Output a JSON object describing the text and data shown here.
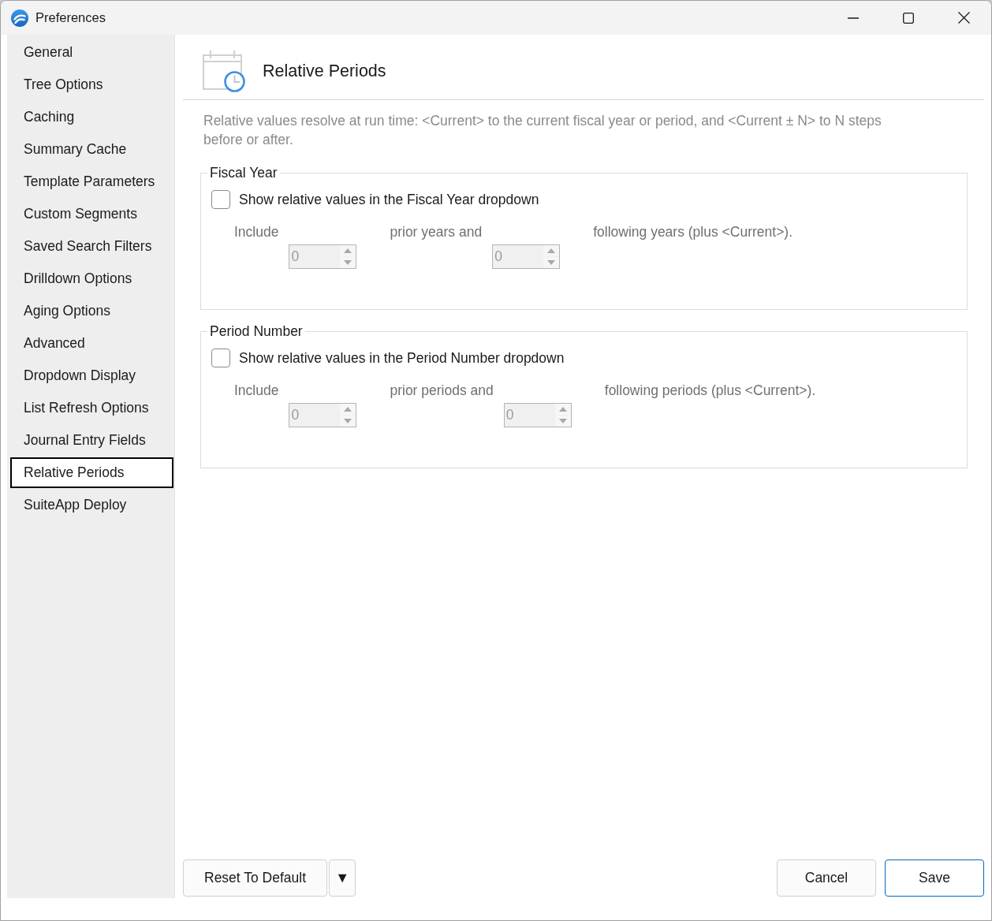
{
  "window": {
    "title": "Preferences"
  },
  "sidebar": {
    "items": [
      {
        "label": "General",
        "selected": false
      },
      {
        "label": "Tree Options",
        "selected": false
      },
      {
        "label": "Caching",
        "selected": false
      },
      {
        "label": "Summary Cache",
        "selected": false
      },
      {
        "label": "Template Parameters",
        "selected": false
      },
      {
        "label": "Custom Segments",
        "selected": false
      },
      {
        "label": "Saved Search Filters",
        "selected": false
      },
      {
        "label": "Drilldown Options",
        "selected": false
      },
      {
        "label": "Aging Options",
        "selected": false
      },
      {
        "label": "Advanced",
        "selected": false
      },
      {
        "label": "Dropdown Display",
        "selected": false
      },
      {
        "label": "List Refresh Options",
        "selected": false
      },
      {
        "label": "Journal Entry Fields",
        "selected": false
      },
      {
        "label": "Relative Periods",
        "selected": true
      },
      {
        "label": "SuiteApp Deploy",
        "selected": false
      }
    ]
  },
  "page": {
    "title": "Relative Periods",
    "description": "Relative values resolve at run time: <Current> to the current fiscal year or period, and <Current ± N> to N steps before or after."
  },
  "groups": [
    {
      "title": "Fiscal Year",
      "checkbox": {
        "label": "Show relative values in the Fiscal Year dropdown",
        "checked": false
      },
      "row": {
        "disabled": true,
        "parts": [
          {
            "kind": "label",
            "text": "Include"
          },
          {
            "kind": "spinner",
            "value": "0"
          },
          {
            "kind": "label",
            "text": "prior years and"
          },
          {
            "kind": "spinner",
            "value": "0"
          },
          {
            "kind": "label",
            "text": "following years (plus <Current>)."
          }
        ]
      }
    },
    {
      "title": "Period Number",
      "checkbox": {
        "label": "Show relative values in the Period Number dropdown",
        "checked": false
      },
      "row": {
        "disabled": true,
        "parts": [
          {
            "kind": "label",
            "text": "Include"
          },
          {
            "kind": "spinner",
            "value": "0"
          },
          {
            "kind": "label",
            "text": "prior periods and"
          },
          {
            "kind": "spinner",
            "value": "0"
          },
          {
            "kind": "label",
            "text": "following periods (plus <Current>)."
          }
        ]
      }
    }
  ],
  "footer": {
    "reset": {
      "label": "Reset To Default",
      "default": false
    },
    "menu": {
      "label": "▼",
      "default": false
    },
    "cancel": {
      "label": "Cancel",
      "default": false
    },
    "save": {
      "label": "Save",
      "default": true
    }
  }
}
